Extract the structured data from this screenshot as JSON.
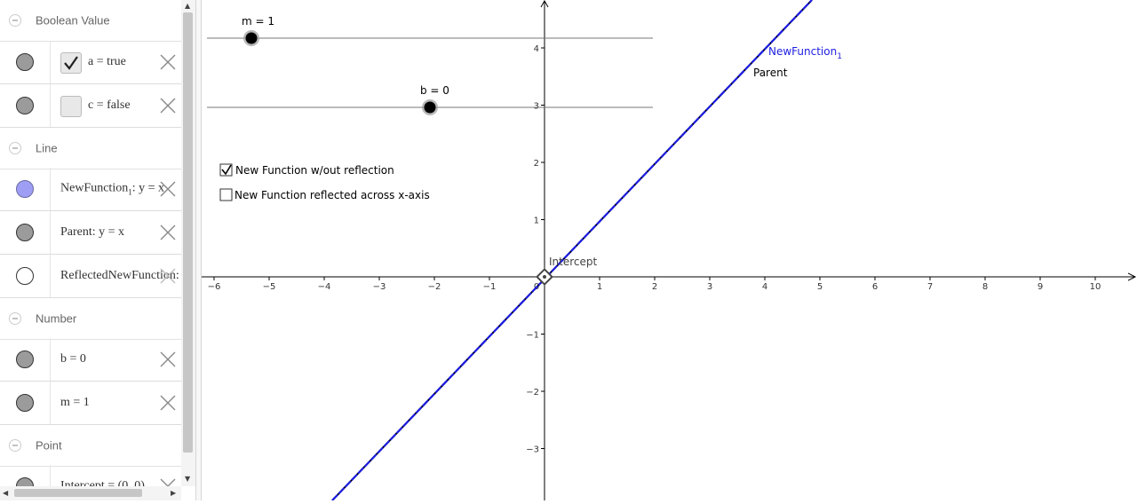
{
  "algebra": {
    "groups": {
      "boolean": "Boolean Value",
      "line": "Line",
      "number": "Number",
      "point": "Point"
    },
    "rows": {
      "a": "a = true",
      "c": "c = false",
      "newfunc_name": "NewFunction",
      "newfunc_sub": "1",
      "newfunc_rest": ": y = x",
      "parent": "Parent: y = x",
      "reflected": "ReflectedNewFunction:",
      "b": "b = 0",
      "m": "m = 1",
      "intercept": "Intercept = (0, 0)"
    }
  },
  "graphics": {
    "slider_m_label": "m = 1",
    "slider_b_label": "b = 0",
    "checkbox_1": {
      "label": "New Function w/out reflection",
      "checked": true
    },
    "checkbox_2": {
      "label": "New Function reflected across x-axis",
      "checked": false
    },
    "label_newfunction": "NewFunction",
    "label_newfunction_sub": "1",
    "label_parent": "Parent",
    "label_intercept": "Intercept",
    "axis_x_ticks": [
      "−6",
      "−5",
      "−4",
      "−3",
      "−2",
      "−1",
      "0",
      "1",
      "2",
      "3",
      "4",
      "5",
      "6",
      "7",
      "8",
      "9",
      "10"
    ],
    "axis_y_ticks": [
      "4",
      "3",
      "2",
      "1",
      "−1",
      "−2",
      "−3"
    ]
  },
  "colors": {
    "newfunction": "#1c1ce0",
    "parent": "#000000"
  }
}
